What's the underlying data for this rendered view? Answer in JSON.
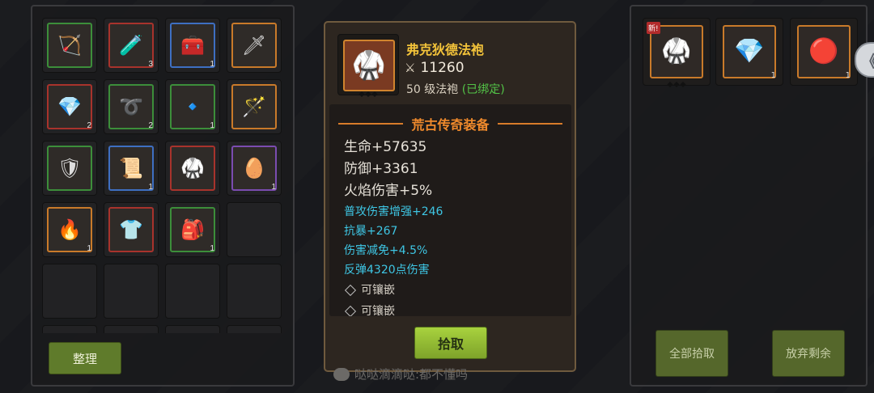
{
  "inventory": {
    "slots": [
      {
        "icon": "bow-icon",
        "glyph": "🏹",
        "rarity": "green",
        "count": ""
      },
      {
        "icon": "potion-icon",
        "glyph": "🧪",
        "rarity": "red",
        "count": "3"
      },
      {
        "icon": "chest-icon",
        "glyph": "🧰",
        "rarity": "blue",
        "count": "1"
      },
      {
        "icon": "sword-icon",
        "glyph": "🗡",
        "rarity": "orange",
        "count": ""
      },
      {
        "icon": "crystal-icon",
        "glyph": "💎",
        "rarity": "red",
        "count": "2"
      },
      {
        "icon": "rope-icon",
        "glyph": "➰",
        "rarity": "green",
        "count": "2"
      },
      {
        "icon": "gem-icon",
        "glyph": "🔹",
        "rarity": "green",
        "count": "1"
      },
      {
        "icon": "staff-icon",
        "glyph": "🪄",
        "rarity": "orange",
        "count": ""
      },
      {
        "icon": "armor-icon",
        "glyph": "🛡",
        "rarity": "green",
        "count": ""
      },
      {
        "icon": "scroll-icon",
        "glyph": "📜",
        "rarity": "blue",
        "count": "1"
      },
      {
        "icon": "robe-icon",
        "glyph": "🥋",
        "rarity": "red",
        "count": ""
      },
      {
        "icon": "egg-icon",
        "glyph": "🥚",
        "rarity": "purple",
        "count": "1"
      },
      {
        "icon": "fire-orb-icon",
        "glyph": "🔥",
        "rarity": "orange",
        "count": "1"
      },
      {
        "icon": "chestplate-icon",
        "glyph": "👕",
        "rarity": "red",
        "count": ""
      },
      {
        "icon": "backpack-icon",
        "glyph": "🎒",
        "rarity": "green",
        "count": "1"
      },
      {
        "icon": "",
        "glyph": "",
        "rarity": "",
        "count": ""
      },
      {
        "icon": "",
        "glyph": "",
        "rarity": "",
        "count": ""
      },
      {
        "icon": "",
        "glyph": "",
        "rarity": "",
        "count": ""
      },
      {
        "icon": "",
        "glyph": "",
        "rarity": "",
        "count": ""
      },
      {
        "icon": "",
        "glyph": "",
        "rarity": "",
        "count": ""
      },
      {
        "icon": "",
        "glyph": "",
        "rarity": "",
        "count": ""
      },
      {
        "icon": "",
        "glyph": "",
        "rarity": "",
        "count": ""
      },
      {
        "icon": "",
        "glyph": "",
        "rarity": "",
        "count": ""
      },
      {
        "icon": "",
        "glyph": "",
        "rarity": "",
        "count": ""
      }
    ],
    "sort_label": "整理"
  },
  "tooltip": {
    "item_name": "弗克狄德法袍",
    "power": "11260",
    "level_prefix": "50",
    "level_text": "级法袍",
    "bound_text": "(已绑定)",
    "section_title": "荒古传奇装备",
    "main_stats": [
      "生命+57635",
      "防御+3361",
      "火焰伤害+5%"
    ],
    "extra_stats": [
      "普攻伤害增强+246",
      "抗暴+267",
      "伤害减免+4.5%",
      "反弹4320点伤害"
    ],
    "sockets": [
      "可镶嵌",
      "可镶嵌"
    ],
    "pickup_label": "拾取"
  },
  "chat_hint": "哒哒滴滴哒:都不懂吗",
  "loot": {
    "items": [
      {
        "icon": "robe-icon",
        "glyph": "🥋",
        "new_tag": "新!",
        "count": ""
      },
      {
        "icon": "crystal-icon",
        "glyph": "💎",
        "new_tag": "",
        "count": "1"
      },
      {
        "icon": "red-orb-icon",
        "glyph": "🔴",
        "new_tag": "",
        "count": "1"
      }
    ],
    "pickup_all_label": "全部拾取",
    "discard_rest_label": "放弃剩余"
  },
  "side_tab_glyph": "《"
}
